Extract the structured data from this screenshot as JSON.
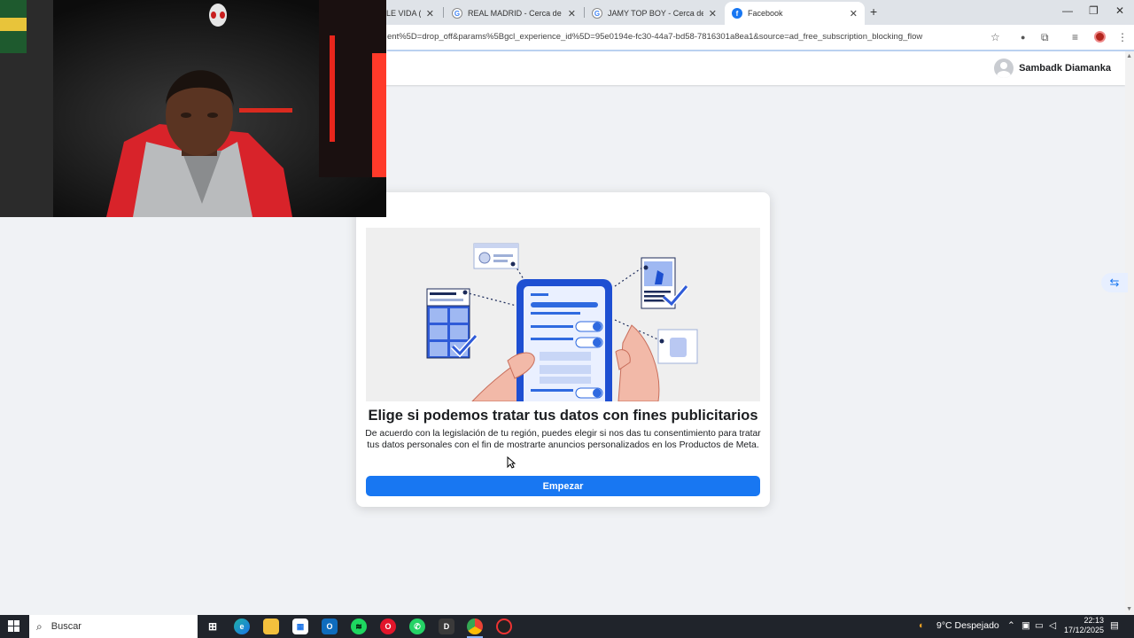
{
  "browser": {
    "tabs": [
      {
        "title": "LE VIDA (Vi",
        "favicon": "youtube"
      },
      {
        "title": "REAL MADRID - Cerca de Goog",
        "favicon": "google-icon"
      },
      {
        "title": "JAMY TOP BOY - Cerca de Goo",
        "favicon": "google-icon"
      },
      {
        "title": "Facebook",
        "favicon": "facebook-icon",
        "active": true
      }
    ],
    "close_glyph": "✕",
    "new_tab_glyph": "+",
    "url": "ent%5D=drop_off&params%5Bgcl_experience_id%5D=95e0194e-fc30-44a7-bd58-7816301a8ea1&source=ad_free_subscription_blocking_flow",
    "window_controls": {
      "minimize": "—",
      "maximize": "❐",
      "close": "✕"
    }
  },
  "header": {
    "user_name": "Sambadk Diamanka"
  },
  "dialog": {
    "title": "Elige si podemos tratar tus datos con fines publicitarios",
    "body": "De acuerdo con la legislación de tu región, puedes elegir si nos das tu consentimiento para tratar tus datos personales con el fin de mostrarte anuncios personalizados en los Productos de Meta.",
    "button_label": "Empezar"
  },
  "colors": {
    "fb_blue": "#1877f2",
    "page_bg": "#f0f2f5",
    "taskbar_bg": "#20242b"
  },
  "taskbar": {
    "search_placeholder": "Buscar",
    "apps": [
      "task-view-icon",
      "edge-icon",
      "file-explorer-icon",
      "store-icon",
      "outlook-icon",
      "spotify-icon",
      "opera-icon",
      "whatsapp-icon",
      "app-d-icon",
      "chrome-icon",
      "chrome-alt-icon"
    ],
    "weather": "9°C  Despejado",
    "time": "22:13",
    "date": "17/12/2025"
  }
}
